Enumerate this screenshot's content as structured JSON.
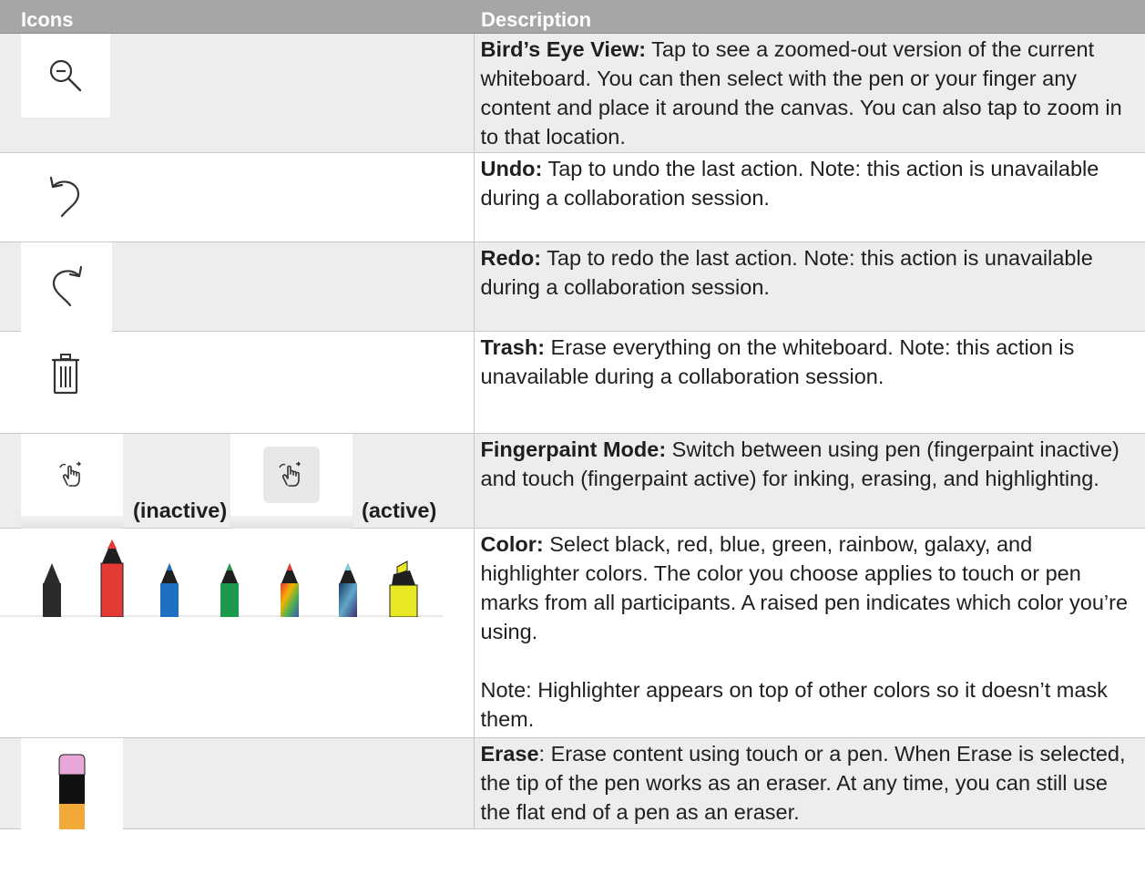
{
  "header": {
    "col1": "Icons",
    "col2": "Description"
  },
  "rows": [
    {
      "icon": "zoom-out-icon",
      "title": "Bird’s Eye View:",
      "text": " Tap to see a zoomed-out version of the current whiteboard. You can then select with the pen or your finger any content and place it around the canvas. You can also tap to zoom in to that location."
    },
    {
      "icon": "undo-icon",
      "title": "Undo:",
      "text": " Tap to undo the last action. Note: this action is unavailable during a collaboration session."
    },
    {
      "icon": "redo-icon",
      "title": "Redo:",
      "text": " Tap to redo the last action. Note: this action is unavailable during a collaboration session."
    },
    {
      "icon": "trash-icon",
      "title": "Trash:",
      "text": " Erase everything on the whiteboard. Note: this action is unavailable during a collaboration session."
    },
    {
      "icon": "fingerpaint-icon",
      "title": "Fingerpaint Mode:",
      "text": " Switch between using pen (fingerpaint inactive) and touch (fingerpaint active) for inking, erasing, and highlighting.",
      "inactive_label": "(inactive)",
      "active_label": "(active)"
    },
    {
      "icon": "color-pens-icon",
      "title": "Color:",
      "text": " Select black, red, blue, green, rainbow, galaxy, and highlighter colors. The color you choose applies to touch or pen marks from all participants. A raised pen indicates which color you’re using.",
      "note": "Note: Highlighter appears on top of other colors so it doesn’t mask them.",
      "pens": [
        "black",
        "red",
        "blue",
        "green",
        "rainbow",
        "galaxy",
        "highlighter"
      ]
    },
    {
      "icon": "eraser-icon",
      "title": "Erase",
      "text": ": Erase content using touch or a pen. When Erase is selected, the tip of the pen works as an eraser. At any time, you can still use the flat end of a pen as an eraser."
    }
  ],
  "colors": {
    "header_bg": "#a6a6a6",
    "row_shade": "#ededed",
    "pen_black": "#2b2b2b",
    "pen_red": "#e53935",
    "pen_blue": "#1e6fc2",
    "pen_green": "#1b9a4b",
    "pen_highlighter": "#e8e824",
    "eraser_pink": "#e7a8d8",
    "eraser_orange": "#f3a938"
  }
}
